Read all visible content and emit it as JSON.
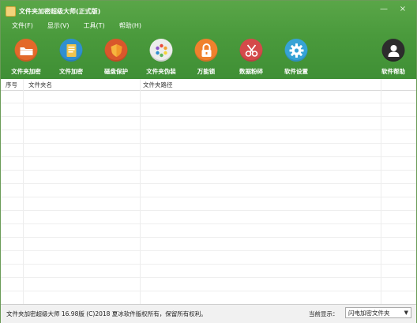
{
  "window": {
    "title": "文件夹加密超级大师(正式版)",
    "minimize_glyph": "—",
    "close_glyph": "×"
  },
  "menu": {
    "items": [
      "文件(F)",
      "显示(V)",
      "工具(T)",
      "帮助(H)"
    ]
  },
  "toolbar": {
    "items": [
      {
        "label": "文件夹加密",
        "icon": "folder-icon",
        "color": "#e3692a"
      },
      {
        "label": "文件加密",
        "icon": "document-icon",
        "color": "#2f8fd0"
      },
      {
        "label": "磁盘保护",
        "icon": "shield-icon",
        "color": "#d9572b"
      },
      {
        "label": "文件夹伪装",
        "icon": "palette-icon",
        "color": "#ececec"
      },
      {
        "label": "万能锁",
        "icon": "lock-icon",
        "color": "#f0812d"
      },
      {
        "label": "数据粉碎",
        "icon": "scissors-icon",
        "color": "#d44a4a"
      },
      {
        "label": "软件设置",
        "icon": "gear-icon",
        "color": "#36a3d6"
      },
      {
        "label": "软件帮助",
        "icon": "user-icon",
        "color": "#2d2d2d"
      }
    ]
  },
  "table": {
    "columns": [
      "序号",
      "文件夹名",
      "文件夹路径"
    ]
  },
  "status": {
    "left_text": "文件夹加密超级大师 16.98版 (C)2018 夏冰软件版权所有，保留所有权利。",
    "display_label": "当前显示：",
    "display_value": "闪电加密文件夹"
  }
}
